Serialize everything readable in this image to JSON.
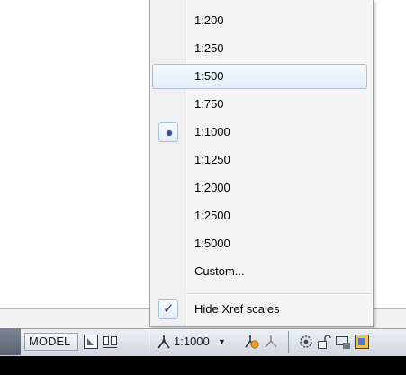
{
  "menu": {
    "scales": [
      {
        "label": "1:200"
      },
      {
        "label": "1:250"
      },
      {
        "label": "1:500",
        "hover": true
      },
      {
        "label": "1:750"
      },
      {
        "label": "1:1000",
        "selected": true
      },
      {
        "label": "1:1250"
      },
      {
        "label": "1:2000"
      },
      {
        "label": "1:2500"
      },
      {
        "label": "1:5000"
      },
      {
        "label": "Custom..."
      }
    ],
    "hide_xref": {
      "label": "Hide Xref scales",
      "checked": true
    }
  },
  "statusbar": {
    "model_label": "MODEL",
    "annotation_scale": "1:1000",
    "dropdown_glyph": "▼",
    "icons": [
      "layout-icon",
      "quick-view-icon",
      "annotation-scale-icon",
      "annotation-visibility-icon",
      "auto-scale-icon",
      "workspace-gear-icon",
      "lock-icon",
      "hardware-acceleration-icon",
      "isolate-icon"
    ]
  },
  "colors": {
    "accent_border": "#a7c1de",
    "radio_dot": "#3d4fa0",
    "check": "#1f3a93"
  }
}
